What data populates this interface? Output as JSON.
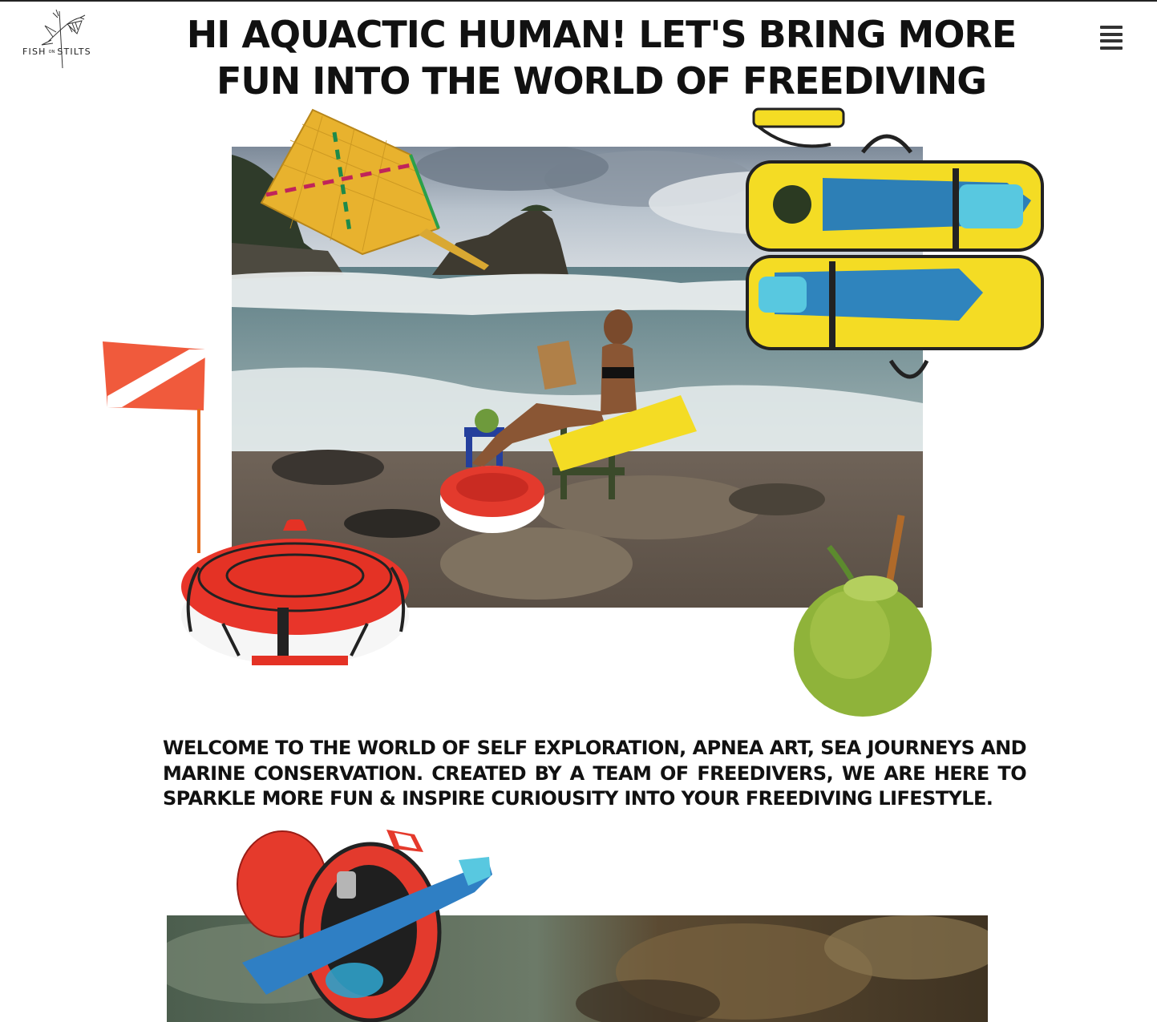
{
  "header": {
    "logo_text_left": "FISH",
    "logo_text_mid": "ON",
    "logo_text_right": "STILTS",
    "menu_icon": "hamburger-menu-icon"
  },
  "hero": {
    "headline": "HI AQUACTIC HUMAN! LET'S BRING MORE FUN INTO THE WORLD OF FREEDIVING"
  },
  "intro": {
    "text": "WELCOME TO THE WORLD OF SELF EXPLORATION, APNEA ART, SEA JOURNEYS AND MARINE CONSERVATION. CREATED BY A TEAM OF FREEDIVERS, WE ARE HERE TO SPARKLE MORE FUN & INSPIRE CURIOUSITY INTO YOUR FREEDIVING LIFESTYLE."
  },
  "colors": {
    "text": "#111111",
    "buoy_red": "#e53a2c",
    "bag_yellow": "#f4dc24",
    "fin_blue": "#2f7fc4",
    "flag_red": "#f05a3c",
    "coconut_green": "#8fb33a"
  }
}
